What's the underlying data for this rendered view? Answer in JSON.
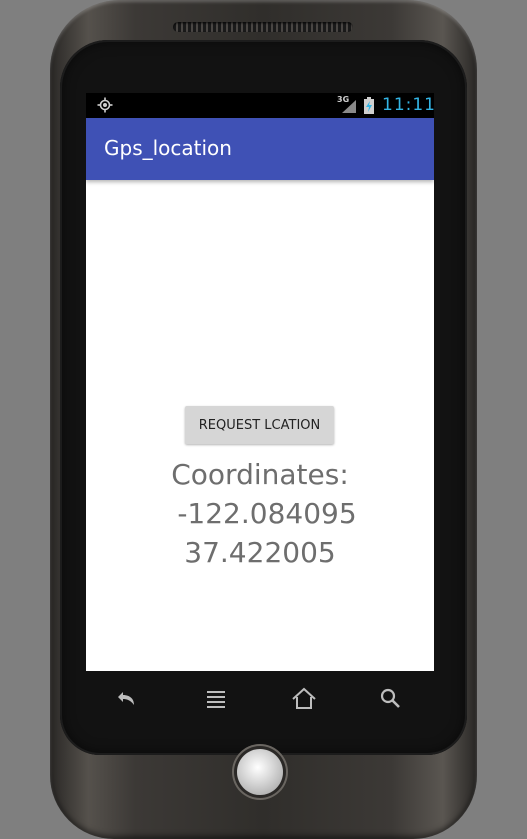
{
  "status_bar": {
    "gps_icon": "gps-crosshair-icon",
    "network_type": "3G",
    "signal_icon": "cell-signal-icon",
    "battery_icon": "battery-charging-icon",
    "time": "11:11",
    "accent": "#33b5e5"
  },
  "app_bar": {
    "title": "Gps_location",
    "color": "#3f51b5"
  },
  "main": {
    "request_button_label": "REQUEST LCATION",
    "coords_label": "Coordinates:",
    "longitude": "-122.084095",
    "latitude": "37.422005"
  },
  "nav_bar": {
    "back_icon": "back-arrow-icon",
    "menu_icon": "menu-icon",
    "home_icon": "home-icon",
    "search_icon": "search-icon"
  }
}
